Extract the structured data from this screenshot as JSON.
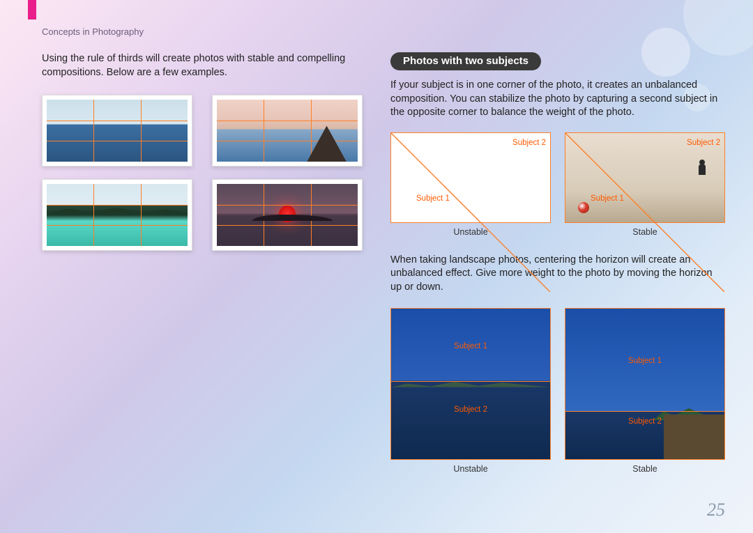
{
  "header": {
    "breadcrumb": "Concepts in Photography"
  },
  "left": {
    "intro": "Using the rule of thirds will create photos with stable and compelling compositions. Below are a few examples."
  },
  "right": {
    "heading": "Photos with two subjects",
    "p1": "If your subject is in one corner of the photo, it creates an unbalanced composition. You can stabilize the photo by capturing a second subject in the opposite corner to balance the weight of the photo.",
    "p2": "When taking landscape photos, centering the horizon will create an unbalanced effect. Give more weight to the photo by moving the horizon up or down.",
    "diagrams": {
      "labels": {
        "s1": "Subject 1",
        "s2": "Subject 2"
      },
      "captions": {
        "unstable": "Unstable",
        "stable": "Stable"
      }
    }
  },
  "page_number": "25"
}
